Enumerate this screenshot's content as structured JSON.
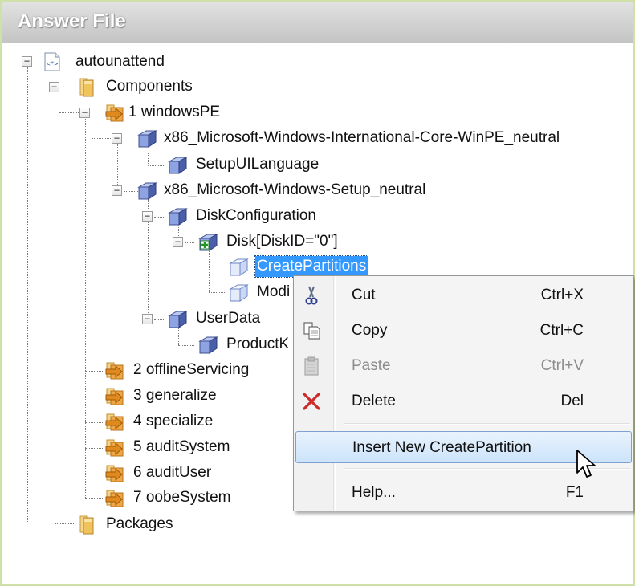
{
  "panel": {
    "title": "Answer File"
  },
  "tree": {
    "root": "autounattend",
    "components": "Components",
    "windowsPE": "1 windowsPE",
    "intl_core": "x86_Microsoft-Windows-International-Core-WinPE_neutral",
    "setup_ui_language": "SetupUILanguage",
    "setup": "x86_Microsoft-Windows-Setup_neutral",
    "disk_configuration": "DiskConfiguration",
    "disk": "Disk[DiskID=\"0\"]",
    "create_partitions": "CreatePartitions",
    "modify_partitions": "Modi",
    "user_data": "UserData",
    "product_key": "ProductK",
    "offline_servicing": "2 offlineServicing",
    "generalize": "3 generalize",
    "specialize": "4 specialize",
    "audit_system": "5 auditSystem",
    "audit_user": "6 auditUser",
    "oobe_system": "7 oobeSystem",
    "packages": "Packages"
  },
  "context_menu": {
    "cut": {
      "label": "Cut",
      "shortcut": "Ctrl+X",
      "icon": "scissors-icon"
    },
    "copy": {
      "label": "Copy",
      "shortcut": "Ctrl+C",
      "icon": "copy-icon"
    },
    "paste": {
      "label": "Paste",
      "shortcut": "Ctrl+V",
      "icon": "paste-icon",
      "enabled": false
    },
    "delete": {
      "label": "Delete",
      "shortcut": "Del",
      "icon": "delete-x-icon"
    },
    "insert": {
      "label": "Insert New CreatePartition",
      "highlighted": true
    },
    "help": {
      "label": "Help...",
      "shortcut": "F1"
    }
  },
  "colors": {
    "selection": "#3399ff",
    "menu_highlight_border": "#7da2ce",
    "header_bg": "#d0d0d0",
    "delete_red": "#cc2b2b"
  }
}
